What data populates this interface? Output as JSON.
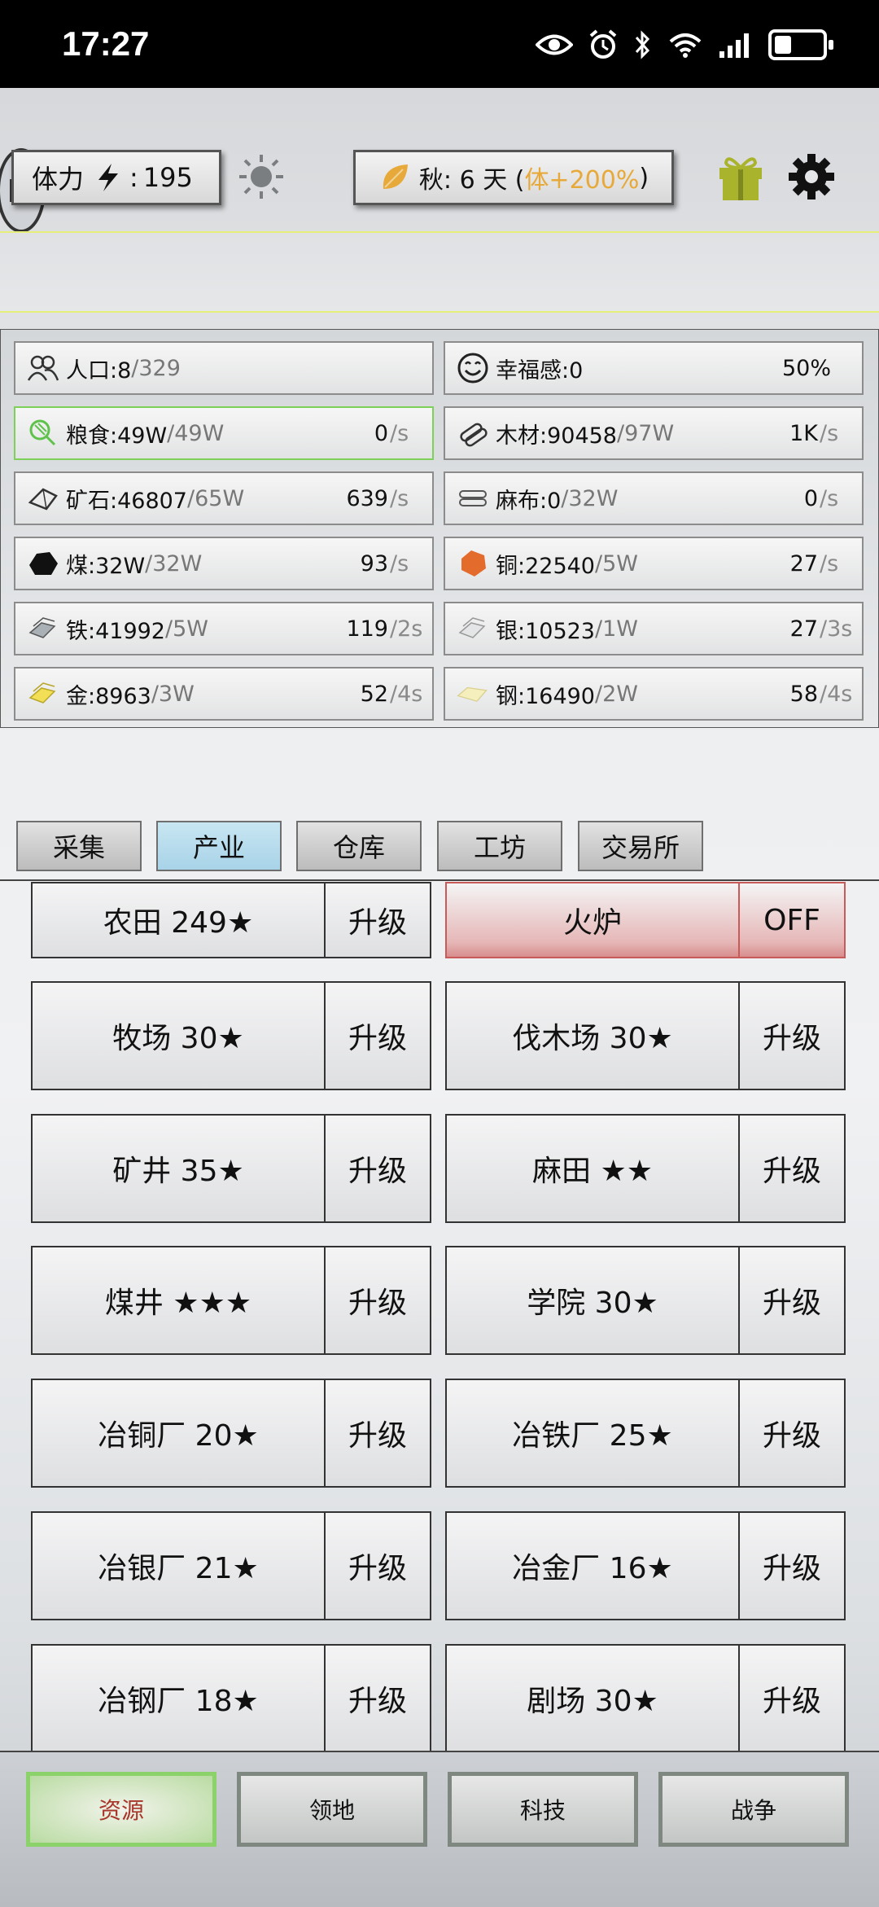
{
  "status_bar": {
    "time": "17:27",
    "battery_level": 0.35,
    "icons": [
      "eye-icon",
      "alarm-icon",
      "bluetooth-icon",
      "wifi-icon",
      "signal-icon",
      "battery-icon"
    ]
  },
  "top_bar": {
    "stamina_label": "体力",
    "stamina_sep": ":",
    "stamina_value": "195",
    "season_text": "秋: 6 天 (",
    "season_bonus": "体+200%",
    "season_close": ")"
  },
  "resources": [
    {
      "name": "人口:8",
      "max": "/329",
      "rate": "",
      "unit": "",
      "icon": "people-icon"
    },
    {
      "name": "幸福感:0",
      "max": "",
      "pct": "50%",
      "icon": "smile-icon"
    },
    {
      "name": "粮食:49W",
      "max": "/49W",
      "rate": "0",
      "unit": "/s",
      "icon": "food-icon"
    },
    {
      "name": "木材:90458",
      "max": "/97W",
      "rate": "1K",
      "unit": "/s",
      "icon": "wood-icon"
    },
    {
      "name": "矿石:46807",
      "max": "/65W",
      "rate": "639",
      "unit": "/s",
      "icon": "ore-icon"
    },
    {
      "name": "麻布:0",
      "max": "/32W",
      "rate": "0",
      "unit": "/s",
      "icon": "linen-icon"
    },
    {
      "name": "煤:32W",
      "max": "/32W",
      "rate": "93",
      "unit": "/s",
      "icon": "coal-icon"
    },
    {
      "name": "铜:22540",
      "max": "/5W",
      "rate": "27",
      "unit": "/s",
      "icon": "copper-icon"
    },
    {
      "name": "铁:41992",
      "max": "/5W",
      "rate": "119",
      "unit": "/2s",
      "icon": "iron-icon"
    },
    {
      "name": "银:10523",
      "max": "/1W",
      "rate": "27",
      "unit": "/3s",
      "icon": "silver-icon"
    },
    {
      "name": "金:8963",
      "max": "/3W",
      "rate": "52",
      "unit": "/4s",
      "icon": "gold-icon"
    },
    {
      "name": "钢:16490",
      "max": "/2W",
      "rate": "58",
      "unit": "/4s",
      "icon": "steel-icon"
    }
  ],
  "tabs": [
    "采集",
    "产业",
    "仓库",
    "工坊",
    "交易所"
  ],
  "active_tab": "产业",
  "buildings": [
    {
      "title": "农田  249★",
      "btn": "升级"
    },
    {
      "title": "火炉",
      "btn": "OFF"
    },
    {
      "title": "牧场  30★",
      "btn": "升级"
    },
    {
      "title": "伐木场  30★",
      "btn": "升级"
    },
    {
      "title": "矿井  35★",
      "btn": "升级"
    },
    {
      "title": "麻田  ★★",
      "btn": "升级"
    },
    {
      "title": "煤井  ★★★",
      "btn": "升级"
    },
    {
      "title": "学院  30★",
      "btn": "升级"
    },
    {
      "title": "冶铜厂  20★",
      "btn": "升级"
    },
    {
      "title": "冶铁厂  25★",
      "btn": "升级"
    },
    {
      "title": "冶银厂  21★",
      "btn": "升级"
    },
    {
      "title": "冶金厂  16★",
      "btn": "升级"
    },
    {
      "title": "冶钢厂  18★",
      "btn": "升级"
    },
    {
      "title": "剧场  30★",
      "btn": "升级"
    }
  ],
  "bottom_nav": [
    "资源",
    "领地",
    "科技",
    "战争"
  ],
  "active_nav": "资源",
  "colors": {
    "season_bonus": "#e6a93a",
    "active_tab": "#b3daec",
    "active_nav_border": "#8bd26b",
    "furnace_red": "#d88d8d"
  }
}
